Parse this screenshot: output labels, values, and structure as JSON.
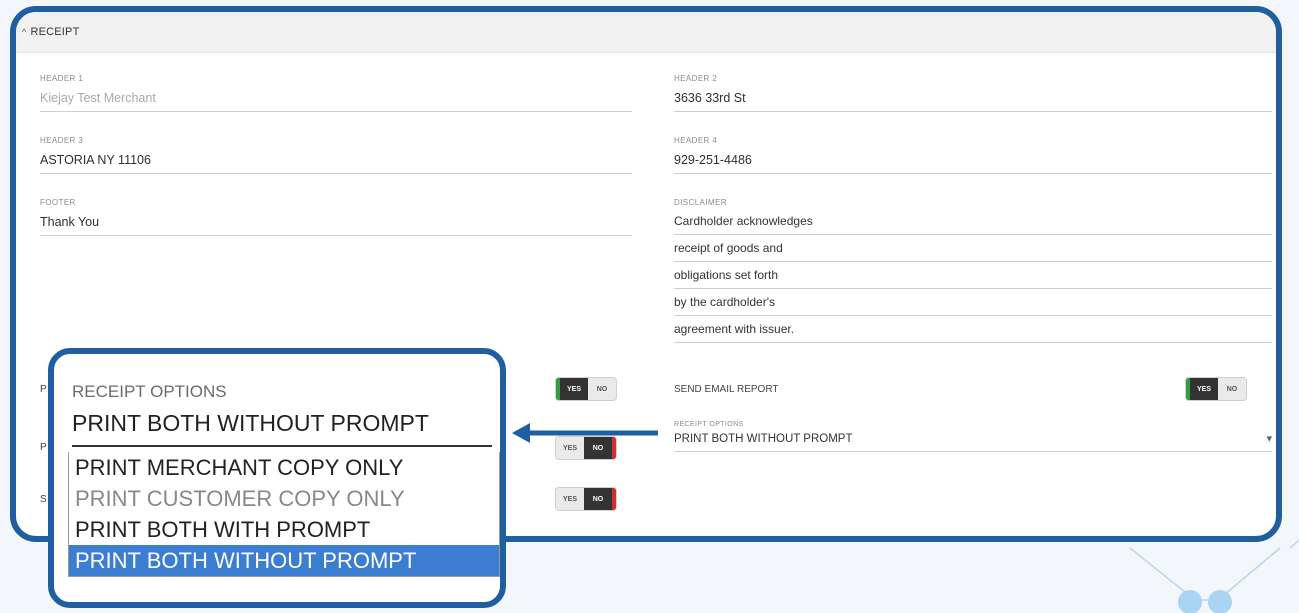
{
  "section": {
    "title": "RECEIPT"
  },
  "fields": {
    "header1": {
      "label": "HEADER 1",
      "value": "Kiejay Test Merchant"
    },
    "header2": {
      "label": "HEADER 2",
      "value": "3636 33rd St"
    },
    "header3": {
      "label": "HEADER 3",
      "value": "ASTORIA NY 11106"
    },
    "header4": {
      "label": "HEADER 4",
      "value": "929-251-4486"
    },
    "footer": {
      "label": "FOOTER",
      "value": "Thank You"
    },
    "disclaimer": {
      "label": "DISCLAIMER",
      "lines": [
        "Cardholder acknowledges",
        "receipt of goods and",
        "obligations set forth",
        "by the cardholder's",
        "agreement with issuer."
      ]
    }
  },
  "toggles": {
    "send_email_report": {
      "label": "SEND EMAIL REPORT",
      "yes": "YES",
      "no": "NO",
      "value": "yes"
    },
    "left1": {
      "label": "P",
      "yes": "YES",
      "no": "NO",
      "value": "yes"
    },
    "left2": {
      "label": "P",
      "yes": "YES",
      "no": "NO",
      "value": "no"
    },
    "left3": {
      "label": "S",
      "yes": "YES",
      "no": "NO",
      "value": "no"
    }
  },
  "receipt_options": {
    "label": "RECEIPT OPTIONS",
    "selected": "PRINT BOTH WITHOUT PROMPT",
    "options": [
      "PRINT MERCHANT COPY ONLY",
      "PRINT CUSTOMER COPY ONLY",
      "PRINT BOTH WITH PROMPT",
      "PRINT BOTH WITHOUT PROMPT"
    ],
    "caret": "▾"
  },
  "colors": {
    "frame": "#1f5fa0",
    "highlight": "#3b7dd0",
    "yes_accent": "#2e9e3f",
    "no_accent": "#d32f2f"
  },
  "icons": {
    "section_caret": "chevron-up-icon",
    "dropdown": "chevron-down-icon",
    "callout": "arrow-left-icon"
  }
}
